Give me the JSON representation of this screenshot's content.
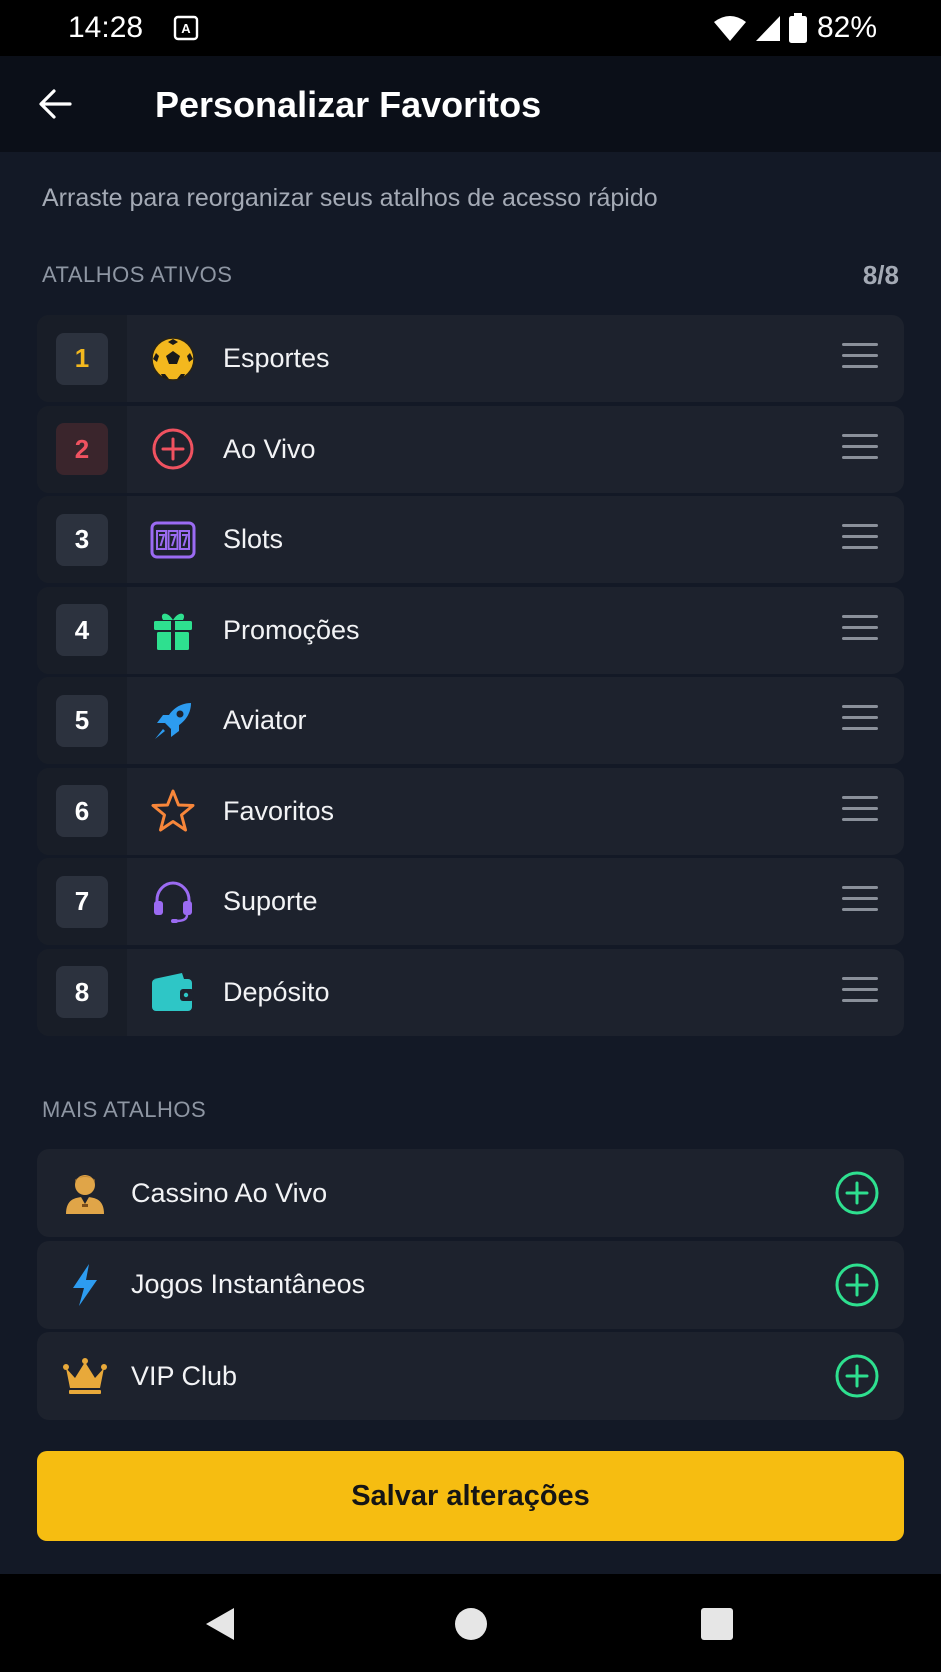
{
  "status_bar": {
    "time": "14:28",
    "battery_text": "82%",
    "icons": [
      "notification-icon",
      "wifi-icon",
      "signal-icon",
      "battery-icon"
    ]
  },
  "header": {
    "title": "Personalizar Favoritos",
    "back_icon": "arrow-left-icon"
  },
  "subtitle": "Arraste para reorganizar seus atalhos de acesso rápido",
  "active": {
    "label": "ATALHOS ATIVOS",
    "count": "8/8",
    "items": [
      {
        "num": "1",
        "label": "Esportes",
        "icon": "soccer-ball-icon"
      },
      {
        "num": "2",
        "label": "Ao Vivo",
        "icon": "live-plus-icon"
      },
      {
        "num": "3",
        "label": "Slots",
        "icon": "slot-machine-icon"
      },
      {
        "num": "4",
        "label": "Promoções",
        "icon": "gift-icon"
      },
      {
        "num": "5",
        "label": "Aviator",
        "icon": "rocket-icon"
      },
      {
        "num": "6",
        "label": "Favoritos",
        "icon": "star-icon"
      },
      {
        "num": "7",
        "label": "Suporte",
        "icon": "headset-icon"
      },
      {
        "num": "8",
        "label": "Depósito",
        "icon": "wallet-icon"
      }
    ]
  },
  "more": {
    "label": "MAIS ATALHOS",
    "items": [
      {
        "label": "Cassino Ao Vivo",
        "icon": "dealer-icon"
      },
      {
        "label": "Jogos Instantâneos",
        "icon": "lightning-icon"
      },
      {
        "label": "VIP Club",
        "icon": "crown-icon"
      }
    ]
  },
  "save_label": "Salvar alterações",
  "colors": {
    "accent": "#f6bd11",
    "add": "#2ee08f",
    "background": "#131926",
    "row": "#1d222d"
  }
}
